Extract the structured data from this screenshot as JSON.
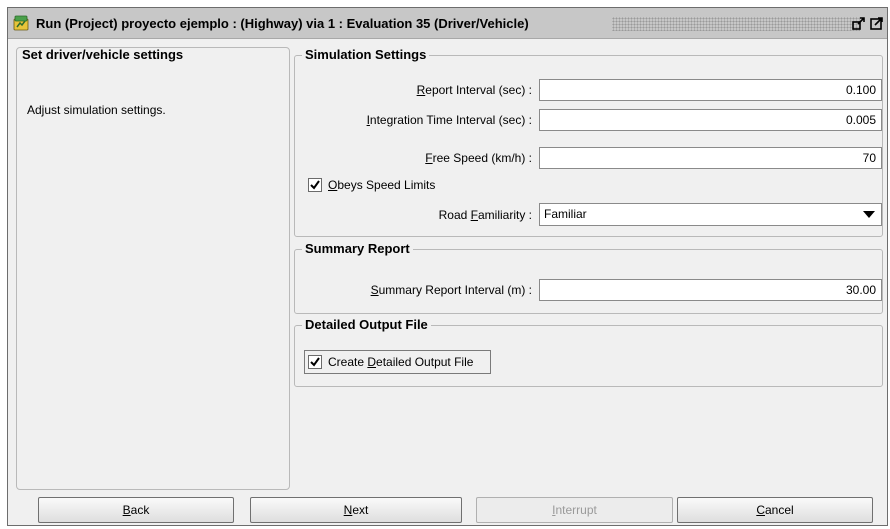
{
  "window": {
    "title": "Run (Project) proyecto ejemplo : (Highway) via 1 : Evaluation 35 (Driver/Vehicle)"
  },
  "left_panel": {
    "heading": "Set driver/vehicle settings",
    "description": "Adjust simulation settings."
  },
  "simulation_settings": {
    "heading": "Simulation Settings",
    "report_interval": {
      "mnemonic": "R",
      "label_rest": "eport Interval (sec) :",
      "value": "0.100"
    },
    "integration_interval": {
      "mnemonic": "I",
      "label_rest": "ntegration Time Interval (sec) :",
      "value": "0.005"
    },
    "free_speed": {
      "mnemonic": "F",
      "label_rest": "ree Speed (km/h) :",
      "value": "70"
    },
    "obeys_speed_limits": {
      "mnemonic": "O",
      "label_rest": "beys Speed Limits",
      "checked": true
    },
    "road_familiarity": {
      "label_pre": "Road ",
      "mnemonic": "F",
      "label_rest": "amiliarity :",
      "value": "Familiar"
    }
  },
  "summary_report": {
    "heading": "Summary Report",
    "interval": {
      "mnemonic": "S",
      "label_rest": "ummary Report Interval (m) :",
      "value": "30.00"
    }
  },
  "detailed_output": {
    "heading": "Detailed Output File",
    "create": {
      "label_pre": "Create ",
      "mnemonic": "D",
      "label_rest": "etailed Output File",
      "checked": true
    }
  },
  "buttons": {
    "back": {
      "mnemonic": "B",
      "rest": "ack"
    },
    "next": {
      "mnemonic": "N",
      "rest": "ext"
    },
    "interrupt": {
      "mnemonic": "I",
      "rest": "nterrupt"
    },
    "cancel": {
      "mnemonic": "C",
      "rest": "ancel"
    }
  },
  "icons": {
    "app": "highway-app-icon",
    "restore": "restore-icon",
    "maximize": "maximize-icon",
    "dropdown": "dropdown-arrow-icon",
    "checkmark": "checkmark-icon"
  }
}
